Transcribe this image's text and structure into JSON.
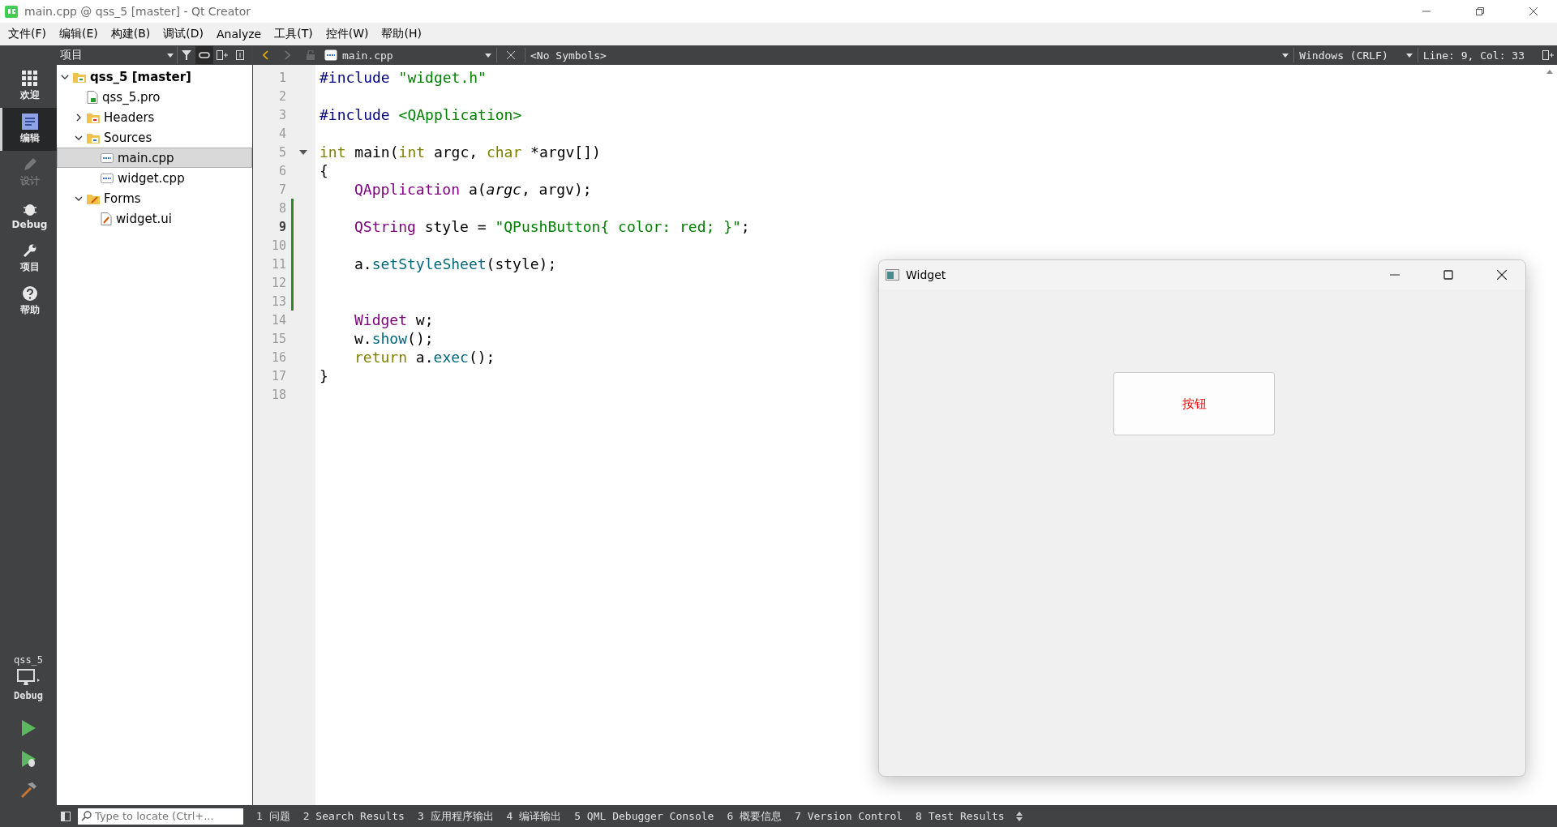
{
  "window": {
    "title": "main.cpp @ qss_5 [master] - Qt Creator"
  },
  "menu": [
    "文件(F)",
    "编辑(E)",
    "构建(B)",
    "调试(D)",
    "Analyze",
    "工具(T)",
    "控件(W)",
    "帮助(H)"
  ],
  "modes": [
    {
      "label": "欢迎",
      "kind": "welcome",
      "selected": false,
      "disabled": false
    },
    {
      "label": "编辑",
      "kind": "edit",
      "selected": true,
      "disabled": false
    },
    {
      "label": "设计",
      "kind": "design",
      "selected": false,
      "disabled": true
    },
    {
      "label": "Debug",
      "kind": "debug",
      "selected": false,
      "disabled": false
    },
    {
      "label": "项目",
      "kind": "projects",
      "selected": false,
      "disabled": false
    },
    {
      "label": "帮助",
      "kind": "help",
      "selected": false,
      "disabled": false
    }
  ],
  "kit": {
    "project": "qss_5",
    "config": "Debug"
  },
  "project_panel": {
    "view": "项目",
    "tree": [
      {
        "label": "qss_5 [master]",
        "kind": "project",
        "expanded": true,
        "selected": false,
        "children": [
          {
            "label": "qss_5.pro",
            "kind": "pro",
            "selected": false
          },
          {
            "label": "Headers",
            "kind": "folder-h",
            "expanded": false,
            "selected": false
          },
          {
            "label": "Sources",
            "kind": "folder-cpp",
            "expanded": true,
            "selected": false,
            "children": [
              {
                "label": "main.cpp",
                "kind": "cpp",
                "selected": true
              },
              {
                "label": "widget.cpp",
                "kind": "cpp",
                "selected": false
              }
            ]
          },
          {
            "label": "Forms",
            "kind": "folder-form",
            "expanded": true,
            "selected": false,
            "children": [
              {
                "label": "widget.ui",
                "kind": "ui",
                "selected": false
              }
            ]
          }
        ]
      }
    ]
  },
  "editor_toolbar": {
    "file": "main.cpp",
    "symbols": "<No Symbols>",
    "line_endings": "Windows (CRLF)",
    "position": "Line: 9, Col: 33"
  },
  "code": [
    {
      "n": "1",
      "current": false,
      "modified": false,
      "tokens": [
        {
          "t": "#include ",
          "kind": "pre"
        },
        {
          "t": "\"widget.h\"",
          "kind": "str"
        }
      ]
    },
    {
      "n": "2",
      "current": false,
      "modified": false
    },
    {
      "n": "3",
      "current": false,
      "modified": false,
      "tokens": [
        {
          "t": "#include ",
          "kind": "pre"
        },
        {
          "t": "<QApplication>",
          "kind": "str"
        }
      ]
    },
    {
      "n": "4",
      "current": false,
      "modified": false
    },
    {
      "n": "5",
      "current": false,
      "modified": false,
      "fold": true,
      "tokens": [
        {
          "t": "int",
          "kind": "kw"
        },
        {
          "t": " main(",
          "kind": "plain"
        },
        {
          "t": "int",
          "kind": "kw"
        },
        {
          "t": " argc, ",
          "kind": "plain"
        },
        {
          "t": "char",
          "kind": "kw"
        },
        {
          "t": " *argv[])",
          "kind": "plain"
        }
      ]
    },
    {
      "n": "6",
      "current": false,
      "modified": false,
      "tokens": [
        {
          "t": "{",
          "kind": "plain"
        }
      ]
    },
    {
      "n": "7",
      "current": false,
      "modified": false,
      "indented": true,
      "tokens": [
        {
          "t": "QApplication",
          "kind": "type"
        },
        {
          "t": " a(",
          "kind": "plain"
        },
        {
          "t": "argc",
          "kind": "param"
        },
        {
          "t": ", argv);",
          "kind": "plain"
        }
      ]
    },
    {
      "n": "8",
      "current": false,
      "modified": true
    },
    {
      "n": "9",
      "current": true,
      "modified": true,
      "indented": true,
      "tokens": [
        {
          "t": "QString",
          "kind": "type"
        },
        {
          "t": " style = ",
          "kind": "plain"
        },
        {
          "t": "\"QPushButton{ color: red; }\"",
          "kind": "str"
        },
        {
          "t": ";",
          "kind": "plain"
        }
      ]
    },
    {
      "n": "10",
      "current": false,
      "modified": true
    },
    {
      "n": "11",
      "current": false,
      "modified": true,
      "indented": true,
      "tokens": [
        {
          "t": "a.",
          "kind": "plain"
        },
        {
          "t": "setStyleSheet",
          "kind": "func"
        },
        {
          "t": "(style);",
          "kind": "plain"
        }
      ]
    },
    {
      "n": "12",
      "current": false,
      "modified": true
    },
    {
      "n": "13",
      "current": false,
      "modified": true
    },
    {
      "n": "14",
      "current": false,
      "modified": false,
      "indented": true,
      "tokens": [
        {
          "t": "Widget",
          "kind": "type"
        },
        {
          "t": " w;",
          "kind": "plain"
        }
      ]
    },
    {
      "n": "15",
      "current": false,
      "modified": false,
      "indented": true,
      "tokens": [
        {
          "t": "w.",
          "kind": "plain"
        },
        {
          "t": "show",
          "kind": "func"
        },
        {
          "t": "();",
          "kind": "plain"
        }
      ]
    },
    {
      "n": "16",
      "current": false,
      "modified": false,
      "indented": true,
      "tokens": [
        {
          "t": "return",
          "kind": "kw"
        },
        {
          "t": " a.",
          "kind": "plain"
        },
        {
          "t": "exec",
          "kind": "func"
        },
        {
          "t": "();",
          "kind": "plain"
        }
      ]
    },
    {
      "n": "17",
      "current": false,
      "modified": false,
      "tokens": [
        {
          "t": "}",
          "kind": "plain"
        }
      ]
    },
    {
      "n": "18",
      "current": false,
      "modified": false
    }
  ],
  "widget_window": {
    "title": "Widget",
    "button": "按钮"
  },
  "status_bar": {
    "locator": {
      "placeholder": "Type to locate (Ctrl+..."
    },
    "panes": [
      "1 问题",
      "2 Search Results",
      "3 应用程序输出",
      "4 编译输出",
      "5 QML Debugger Console",
      "6 概要信息",
      "7 Version Control",
      "8 Test Results"
    ]
  }
}
